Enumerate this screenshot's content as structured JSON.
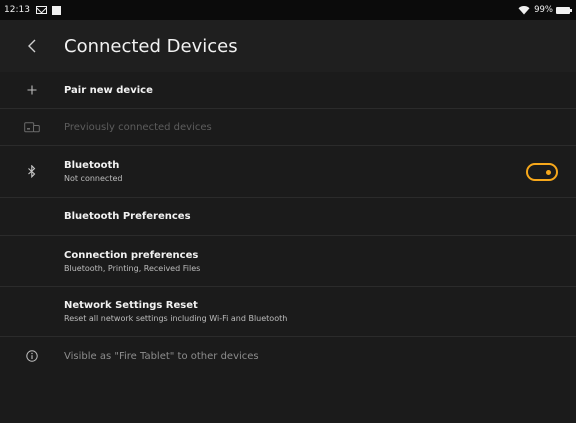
{
  "status_bar": {
    "time": "12:13",
    "battery": "99%",
    "icons": [
      "mail-icon",
      "notification-icon",
      "wifi-icon",
      "battery-icon"
    ]
  },
  "toolbar": {
    "back_icon": "chevron-left-icon",
    "title": "Connected Devices"
  },
  "list": {
    "pair_new": {
      "icon": "plus-icon",
      "label": "Pair new device"
    },
    "previously_connected": {
      "icon": "devices-icon",
      "label": "Previously connected devices"
    },
    "bluetooth": {
      "icon": "bluetooth-icon",
      "label": "Bluetooth",
      "status": "Not connected",
      "toggle_on": true
    },
    "bluetooth_preferences": {
      "label": "Bluetooth Preferences"
    },
    "connection_preferences": {
      "label": "Connection preferences",
      "subtitle": "Bluetooth, Printing, Received Files"
    },
    "network_reset": {
      "label": "Network Settings Reset",
      "subtitle": "Reset all network settings including Wi-Fi and Bluetooth"
    },
    "visibility_info": {
      "icon": "info-icon",
      "text": "Visible as \"Fire Tablet\" to other devices"
    }
  },
  "colors": {
    "background": "#1b1b1b",
    "toolbar": "#1f1f1f",
    "status_bar": "#0b0b0b",
    "accent": "#f7a81b",
    "divider": "#2b2b2b"
  }
}
